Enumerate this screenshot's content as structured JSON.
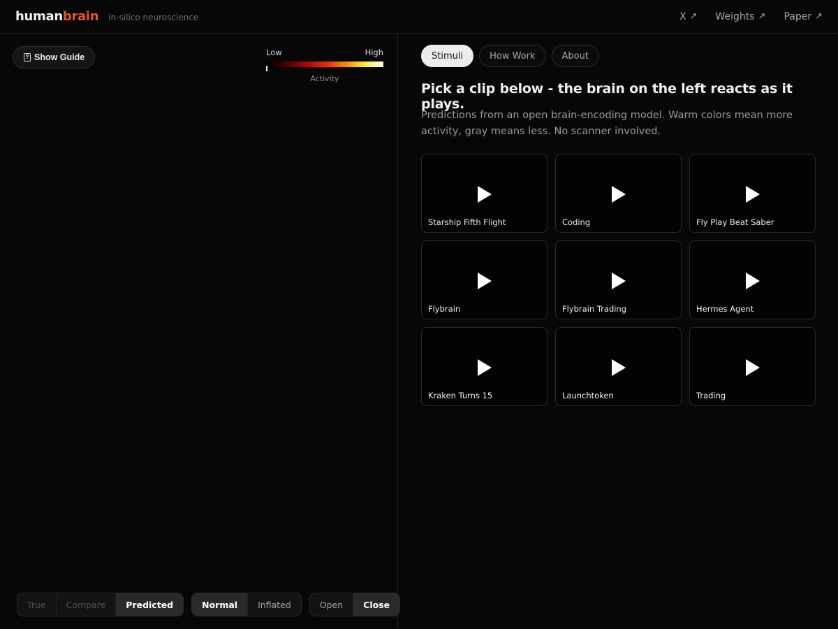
{
  "header": {
    "brand_part1": "human",
    "brand_part2": "brain",
    "tagline": "in-silico neuroscience",
    "links": [
      {
        "label": "X",
        "arrow": "↗"
      },
      {
        "label": "Weights",
        "arrow": "↗"
      },
      {
        "label": "Paper",
        "arrow": "↗"
      }
    ]
  },
  "left": {
    "guide_button": "Show Guide",
    "guide_icon_glyph": "?",
    "legend": {
      "low": "Low",
      "high": "High",
      "caption": "Activity"
    },
    "controls": {
      "source": [
        {
          "label": "True",
          "state": "disabled"
        },
        {
          "label": "Compare",
          "state": "disabled"
        },
        {
          "label": "Predicted",
          "state": "active"
        }
      ],
      "surface": [
        {
          "label": "Normal",
          "state": "active"
        },
        {
          "label": "Inflated",
          "state": "inactive"
        }
      ],
      "panel": [
        {
          "label": "Open",
          "state": "inactive"
        },
        {
          "label": "Close",
          "state": "active"
        }
      ]
    }
  },
  "right": {
    "tabs": [
      {
        "label": "Stimuli",
        "active": true
      },
      {
        "label": "How Work",
        "active": false
      },
      {
        "label": "About",
        "active": false
      }
    ],
    "headline": "Pick a clip below - the brain on the left reacts as it plays.",
    "description": "Predictions from an open brain-encoding model. Warm colors mean more activity, gray means less. No scanner involved.",
    "clips": [
      "Starship Fifth Flight",
      "Coding",
      "Fly Play Beat Saber",
      "Flybrain",
      "Flybrain Trading",
      "Hermes Agent",
      "Kraken Turns 15",
      "Launchtoken",
      "Trading"
    ]
  },
  "colors": {
    "accent": "#e8562a",
    "background": "#070707"
  }
}
